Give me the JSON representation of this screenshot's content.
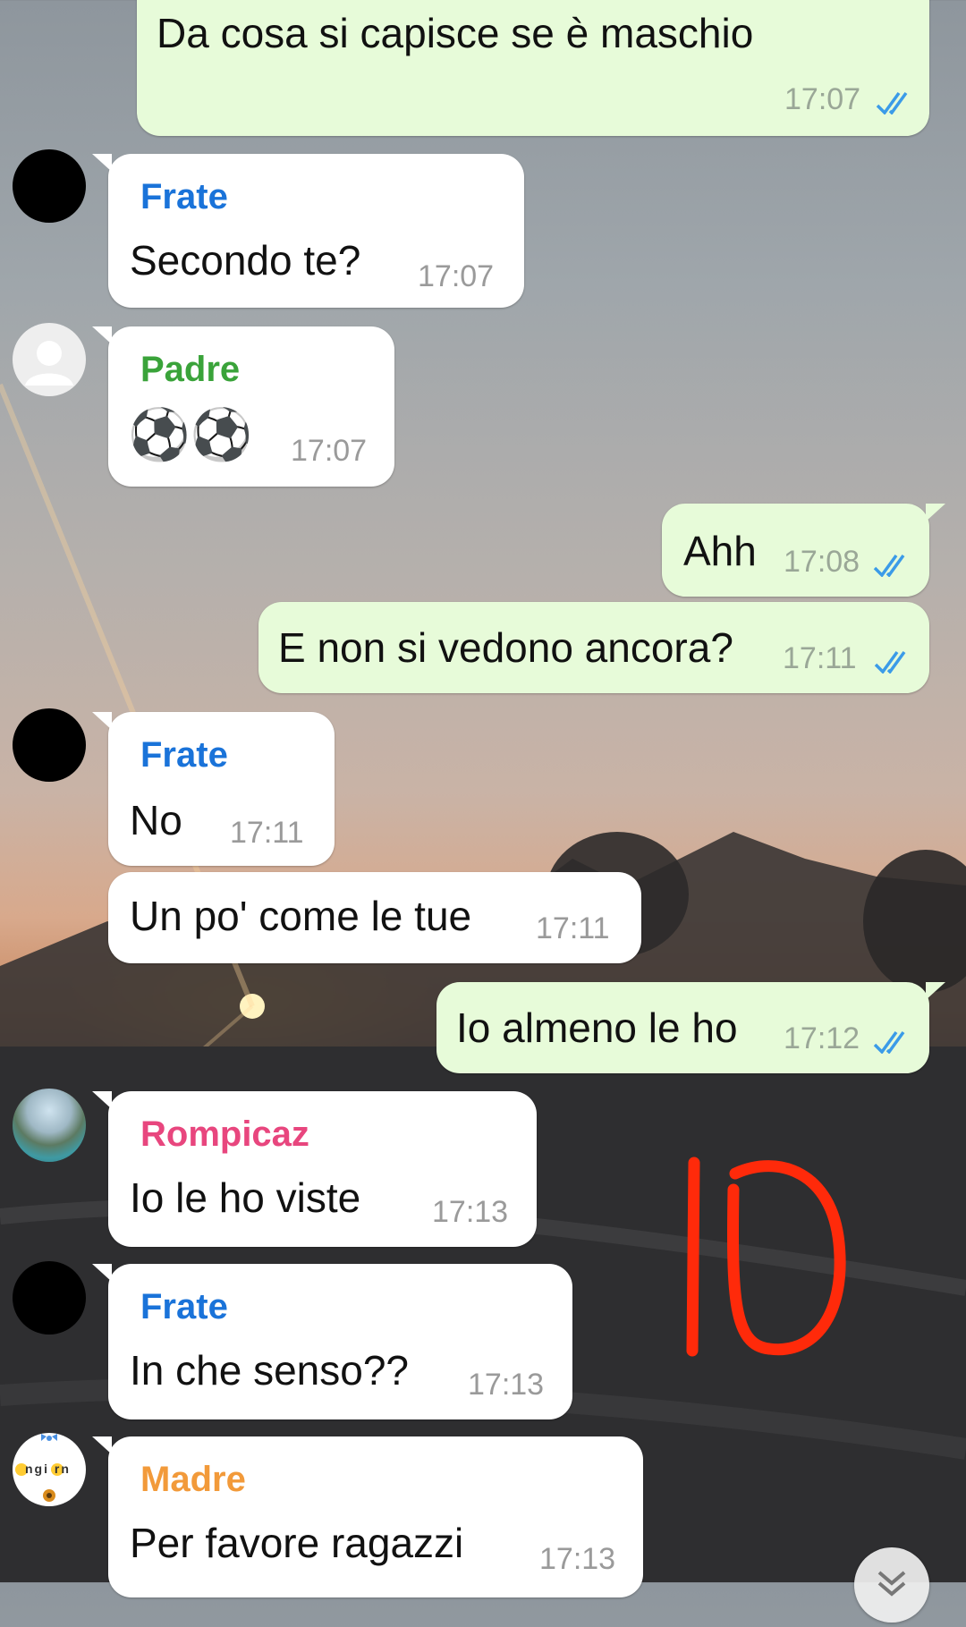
{
  "colors": {
    "outgoing_bubble": "#e7fbd9",
    "incoming_bubble": "#ffffff",
    "frate": "#1a73d9",
    "padre": "#3aa33a",
    "rompicaz": "#e8467e",
    "madre": "#f29a3a",
    "read_ticks": "#3b9be8",
    "annotation": "#ff2a0a"
  },
  "messages": [
    {
      "dir": "out",
      "text": "Da cosa si capisce se è maschio",
      "time": "17:07",
      "read": true
    },
    {
      "dir": "in",
      "sender": "Frate",
      "avatar": "black-avatar",
      "text": "Secondo te?",
      "time": "17:07"
    },
    {
      "dir": "in",
      "sender": "Padre",
      "avatar": "default-avatar-icon",
      "text": "⚽⚽",
      "time": "17:07"
    },
    {
      "dir": "out",
      "text": "Ahh",
      "time": "17:08",
      "read": true
    },
    {
      "dir": "out",
      "text": "E non si vedono ancora?",
      "time": "17:11",
      "read": true
    },
    {
      "dir": "in",
      "sender": "Frate",
      "avatar": "black-avatar",
      "text": "No",
      "time": "17:11"
    },
    {
      "dir": "in",
      "text": "Un po' come le tue",
      "time": "17:11"
    },
    {
      "dir": "out",
      "text": "Io almeno le ho",
      "time": "17:12",
      "read": true
    },
    {
      "dir": "in",
      "sender": "Rompicaz",
      "avatar": "photo-avatar",
      "text": "Io le ho viste",
      "time": "17:13"
    },
    {
      "dir": "in",
      "sender": "Frate",
      "avatar": "black-avatar",
      "text": "In che senso??",
      "time": "17:13"
    },
    {
      "dir": "in",
      "sender": "Madre",
      "avatar": "emoji-avatar",
      "text": "Per favore ragazzi",
      "time": "17:13"
    }
  ],
  "annotation": {
    "icon": "handwritten-10-mark",
    "score": 10
  },
  "madre_avatar_text": "ngi rn",
  "scroll_button_icon": "chevron-down-icon"
}
